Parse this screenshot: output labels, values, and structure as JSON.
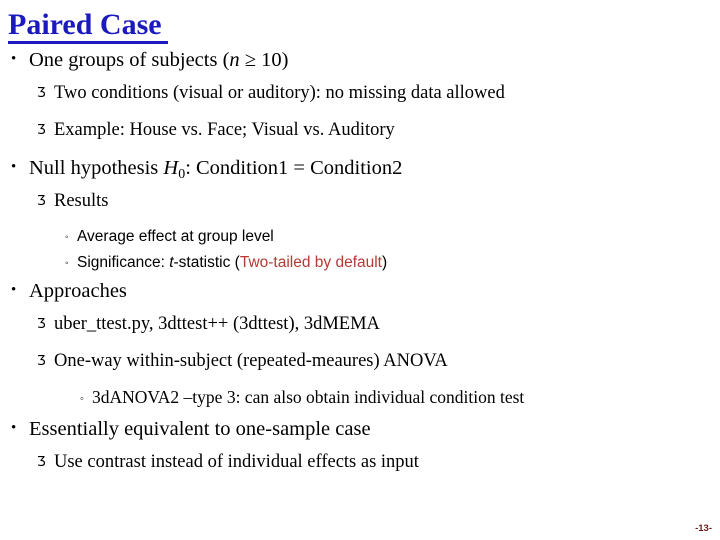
{
  "slide": {
    "title": "Paired Case",
    "page_number": "-13-",
    "title_color": "#1a1aBE",
    "accent_red": "#B53A34",
    "background": "#ffffff",
    "bullets": {
      "level1_glyph": "•",
      "level2_glyph": "Ʒ",
      "level3_glyph": "◦"
    },
    "lines": {
      "l1_subjects_pre": "One groups of subjects (",
      "l1_subjects_var": "n",
      "l1_subjects_post": " ≥ 10)",
      "l2_two_conditions": "Two conditions (visual or auditory): no missing data allowed",
      "l2_example": "Example: House vs. Face; Visual vs. Auditory",
      "l1_null_pre": "Null hypothesis ",
      "l1_null_var": "H",
      "l1_null_sub": "0",
      "l1_null_post": ": Condition1 = Condition2",
      "l2_results": "Results",
      "l3_average": "Average effect at group level",
      "l3_signif_pre": "Significance: ",
      "l3_signif_var": "t",
      "l3_signif_mid": "-statistic (",
      "l3_signif_red": "Two-tailed by default",
      "l3_signif_post": ")",
      "l1_approaches": "Approaches",
      "l2_uber": "uber_ttest.py, 3dttest++ (3dttest), 3dMEMA",
      "l2_oneway": "One-way within-subject (repeated-meaures) ANOVA",
      "l3_anova2": "3dANOVA2 –type 3: can also obtain individual condition test",
      "l1_essentially": "Essentially equivalent to one-sample case",
      "l2_use_contrast": "Use contrast instead of individual effects as input"
    }
  }
}
